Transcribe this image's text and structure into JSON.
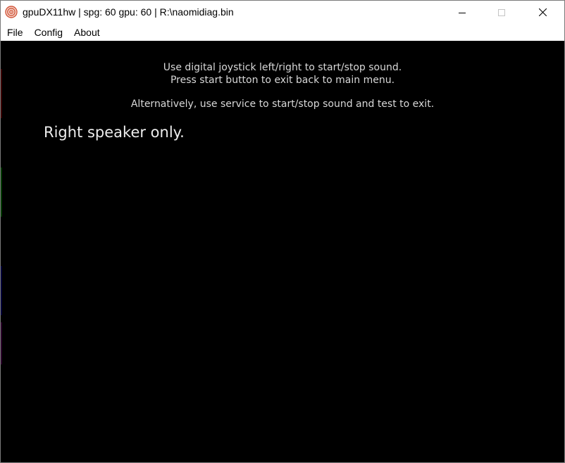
{
  "window": {
    "title": "gpuDX11hw | spg: 60 gpu: 60 | R:\\naomidiag.bin",
    "icon": "swirl-app-icon"
  },
  "menu": {
    "items": [
      "File",
      "Config",
      "About"
    ]
  },
  "screen": {
    "instructions": [
      "Use digital joystick left/right to start/stop sound.",
      "Press start button to exit back to main menu.",
      "Alternatively, use service to start/stop sound and test to exit."
    ],
    "status": "Right speaker only."
  },
  "colors": {
    "screen_background": "#000000",
    "instruction_text": "#d8d8d8",
    "status_text": "#ededed"
  }
}
